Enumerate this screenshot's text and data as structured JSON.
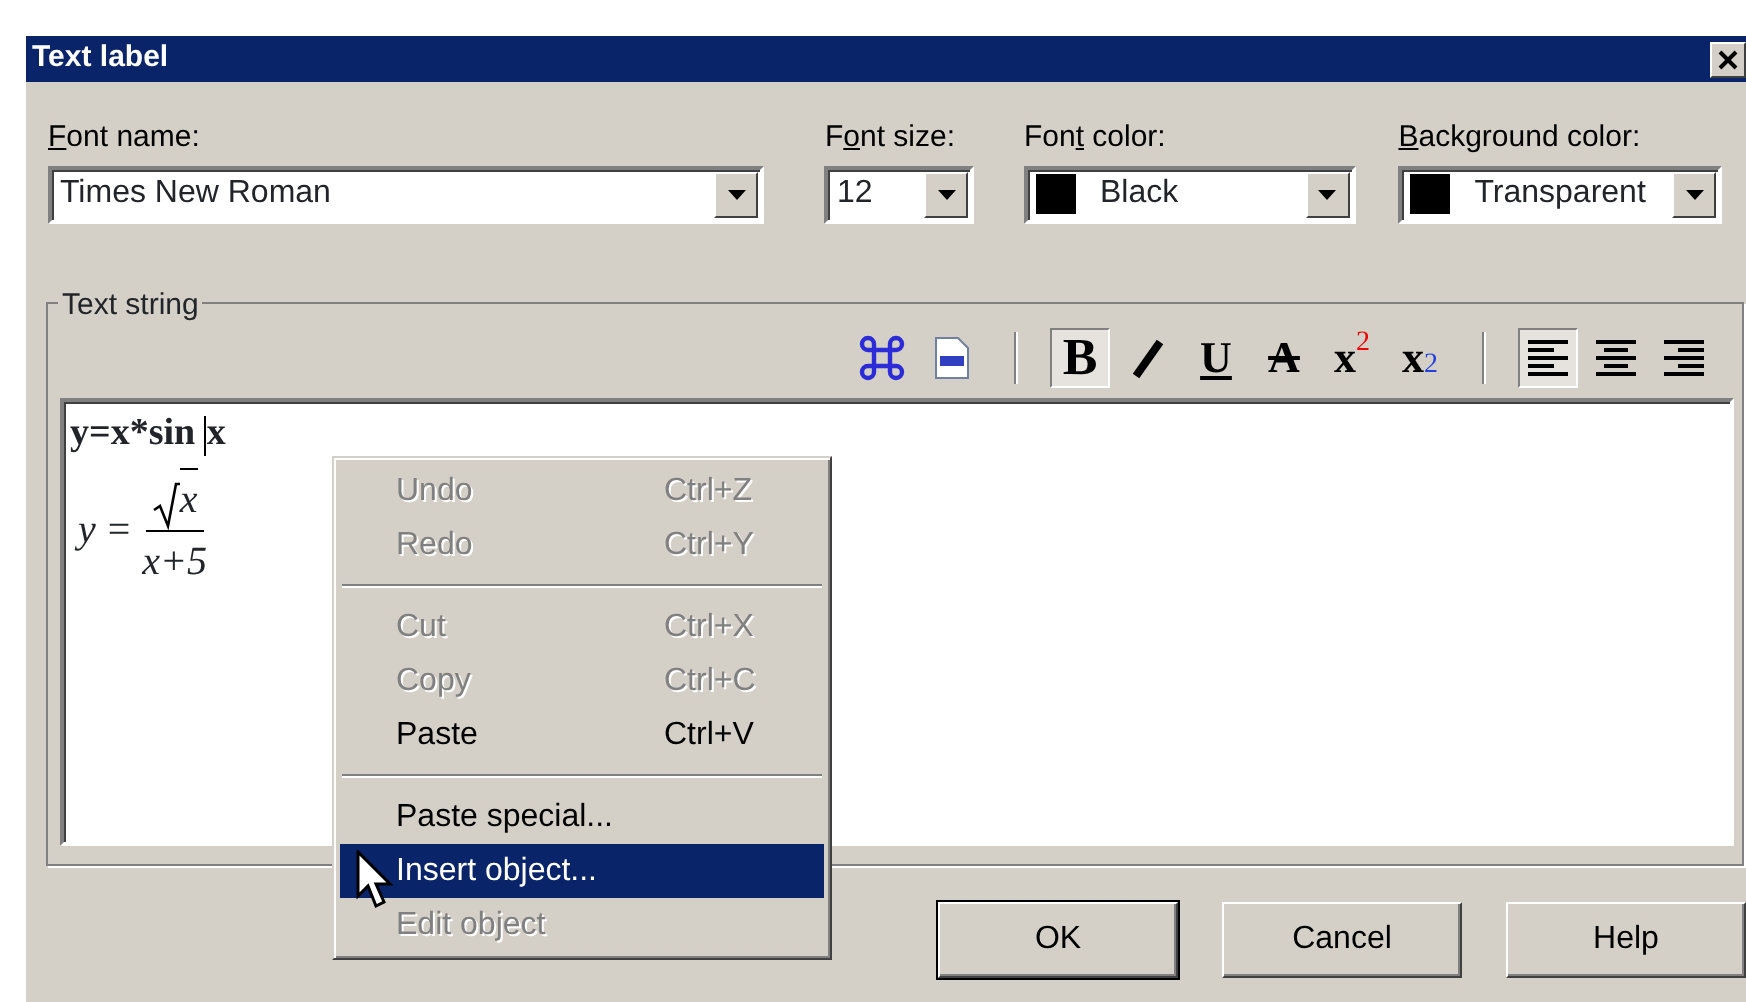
{
  "window": {
    "title": "Text label"
  },
  "fields": [
    {
      "access_key": "F",
      "label_after": "ont name:",
      "value": "Times New Roman",
      "kind": "text"
    },
    {
      "label_before": "F",
      "access_key": "o",
      "label_after": "nt size:",
      "value": "12",
      "kind": "text"
    },
    {
      "label_before": "Fon",
      "access_key": "t",
      "label_after": " color:",
      "value": "Black",
      "kind": "swatch",
      "color": "#000000"
    },
    {
      "access_key": "B",
      "label_after": "ackground color:",
      "value": "Transparent",
      "kind": "swatch",
      "color": "#000000"
    }
  ],
  "group": {
    "title": "Text string"
  },
  "toolbar": [
    {
      "kind": "symbol"
    },
    {
      "kind": "ole"
    },
    {
      "kind": "separator"
    },
    {
      "kind": "bold",
      "label": "B",
      "selected": true
    },
    {
      "kind": "italic",
      "selected": false
    },
    {
      "kind": "underline",
      "label": "U",
      "selected": false
    },
    {
      "kind": "strike",
      "label": "A",
      "selected": false
    },
    {
      "kind": "superscript",
      "label": "x$^{2}$",
      "selected": false
    },
    {
      "kind": "subscript",
      "label": "x$_{2}$",
      "selected": false
    },
    {
      "kind": "separator"
    },
    {
      "kind": "align-left",
      "selected": true
    },
    {
      "kind": "align-center",
      "selected": false
    },
    {
      "kind": "align-right",
      "selected": false
    }
  ],
  "editor": {
    "text_parts": [
      "y=x*sin ",
      "x"
    ],
    "formula": {
      "lhs": "y",
      "equals": "=",
      "radicand": "x",
      "denominator": "x+5"
    }
  },
  "context_menu": [
    {
      "kind": "item",
      "label": "Undo",
      "shortcut": "Ctrl+Z",
      "disabled": true,
      "selected": false
    },
    {
      "kind": "item",
      "label": "Redo",
      "shortcut": "Ctrl+Y",
      "disabled": true,
      "selected": false
    },
    {
      "kind": "separator"
    },
    {
      "kind": "item",
      "label": "Cut",
      "shortcut": "Ctrl+X",
      "disabled": true,
      "selected": false
    },
    {
      "kind": "item",
      "label": "Copy",
      "shortcut": "Ctrl+C",
      "disabled": true,
      "selected": false
    },
    {
      "kind": "item",
      "label": "Paste",
      "shortcut": "Ctrl+V",
      "disabled": false,
      "selected": false
    },
    {
      "kind": "separator"
    },
    {
      "kind": "item",
      "label": "Paste special...",
      "disabled": false,
      "selected": false
    },
    {
      "kind": "item",
      "label": "Insert object...",
      "disabled": false,
      "selected": true
    },
    {
      "kind": "item",
      "label": "Edit object",
      "disabled": true,
      "selected": false
    }
  ],
  "buttons": [
    {
      "label": "OK",
      "default": true
    },
    {
      "label": "Cancel",
      "default": false
    },
    {
      "label": "Help",
      "default": false
    }
  ]
}
